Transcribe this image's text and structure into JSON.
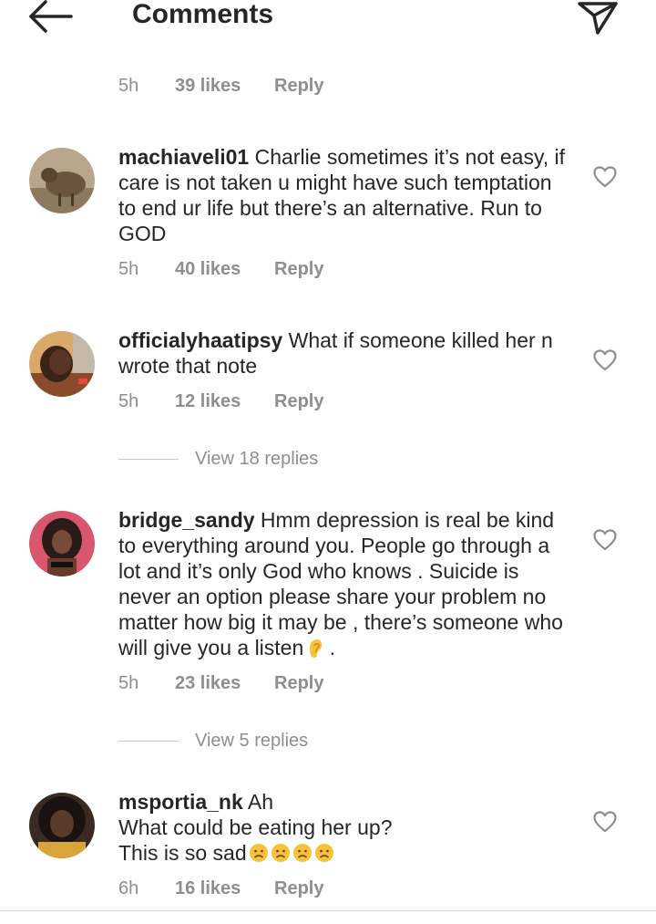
{
  "header": {
    "title": "Comments",
    "back_icon": "arrow-left-icon",
    "share_icon": "send-icon"
  },
  "top_meta": {
    "time": "5h",
    "likes": "39 likes",
    "reply": "Reply"
  },
  "comments": [
    {
      "username": "machiaveli01",
      "text": " Charlie sometimes it’s not easy, if care is not taken u might have such temptation to end ur life but there’s an alternative. Run to GOD",
      "time": "5h",
      "likes": "40 likes",
      "reply": "Reply"
    },
    {
      "username": "officialyhaatipsy",
      "text": " What if someone killed her n wrote that note",
      "time": "5h",
      "likes": "12 likes",
      "reply": "Reply",
      "view_replies": "View 18 replies"
    },
    {
      "username": "bridge_sandy",
      "text": " Hmm depression is real be kind to everything around you. People go  through a lot and it’s only God who knows . Suicide is never an option please share your problem no matter how big it may be , there’s someone who will give you a listen",
      "text_end": " .",
      "time": "5h",
      "likes": "23 likes",
      "reply": "Reply",
      "view_replies": "View 5 replies"
    },
    {
      "username": "msportia_nk",
      "text_line1": " Ah",
      "text_line2": "What could be eating her up?",
      "text_line3": "This is so sad",
      "time": "6h",
      "likes": "16 likes",
      "reply": "Reply"
    }
  ],
  "colors": {
    "text": "#262626",
    "secondary": "#8e8e8e",
    "divider": "#dbdbdb",
    "emoji_yellow": "#f7c23a"
  }
}
